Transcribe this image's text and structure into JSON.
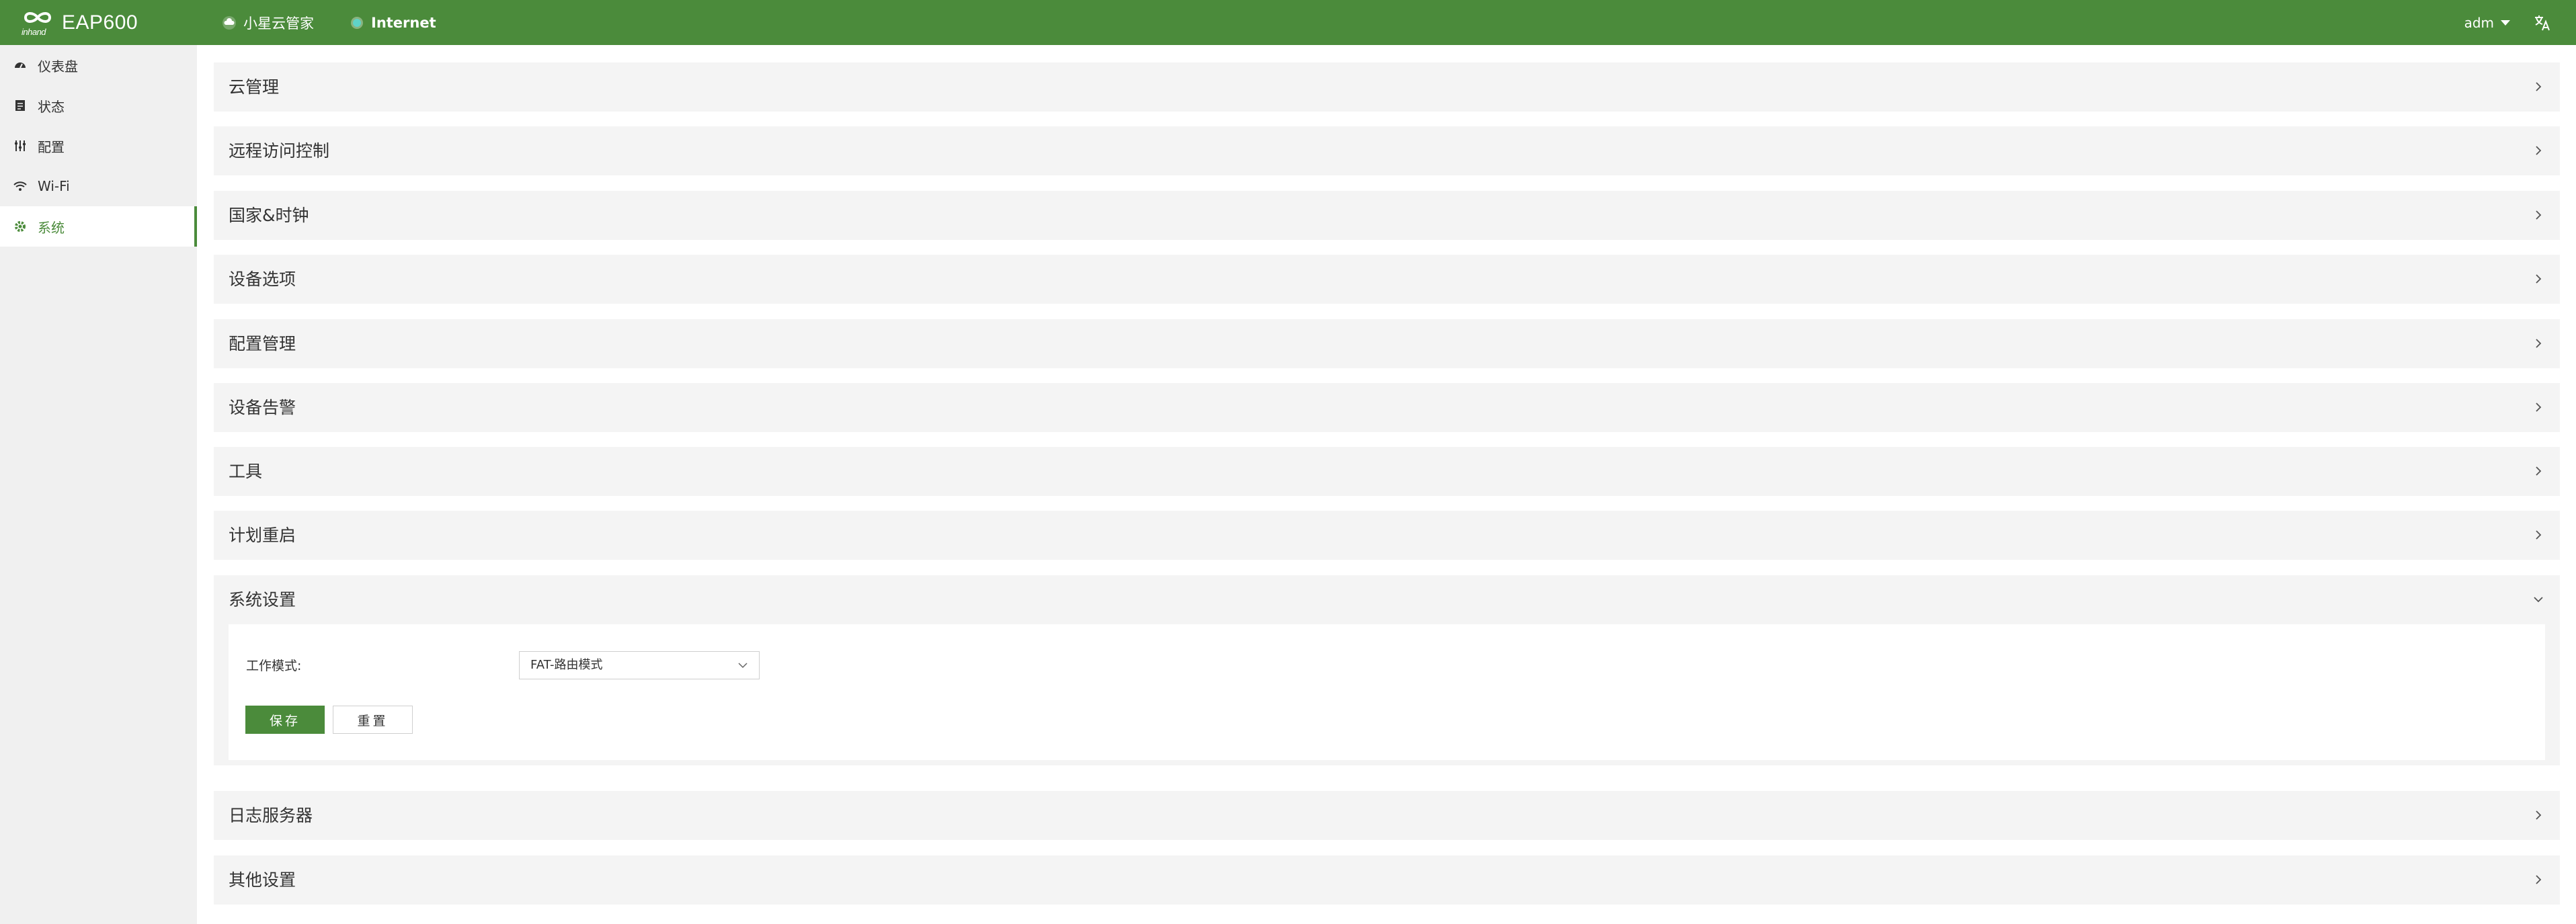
{
  "header": {
    "brand_text": "inhand",
    "title": "EAP600",
    "nav": [
      {
        "label": "小星云管家",
        "icon": "cloud-icon"
      },
      {
        "label": "Internet",
        "icon": "status-dot-icon"
      }
    ],
    "user": "adm",
    "language_icon": "translate-icon"
  },
  "colors": {
    "brand": "#4b8b3b",
    "panel_bg": "#f4f4f4",
    "sidebar_bg": "#f0f0f0",
    "status_dot": "#5fd3c8"
  },
  "sidebar": {
    "items": [
      {
        "label": "仪表盘",
        "icon": "dashboard-icon"
      },
      {
        "label": "状态",
        "icon": "status-icon"
      },
      {
        "label": "配置",
        "icon": "config-sliders-icon"
      },
      {
        "label": "Wi-Fi",
        "icon": "wifi-icon"
      },
      {
        "label": "系统",
        "icon": "gear-icon",
        "active": true
      }
    ]
  },
  "sections": [
    {
      "title": "云管理"
    },
    {
      "title": "远程访问控制"
    },
    {
      "title": "国家&时钟"
    },
    {
      "title": "设备选项"
    },
    {
      "title": "配置管理"
    },
    {
      "title": "设备告警"
    },
    {
      "title": "工具"
    },
    {
      "title": "计划重启"
    },
    {
      "title": "系统设置",
      "expanded": true
    },
    {
      "title": "日志服务器"
    },
    {
      "title": "其他设置"
    }
  ],
  "system_settings": {
    "work_mode_label": "工作模式:",
    "work_mode_value": "FAT-路由模式",
    "save_label": "保存",
    "reset_label": "重置"
  }
}
